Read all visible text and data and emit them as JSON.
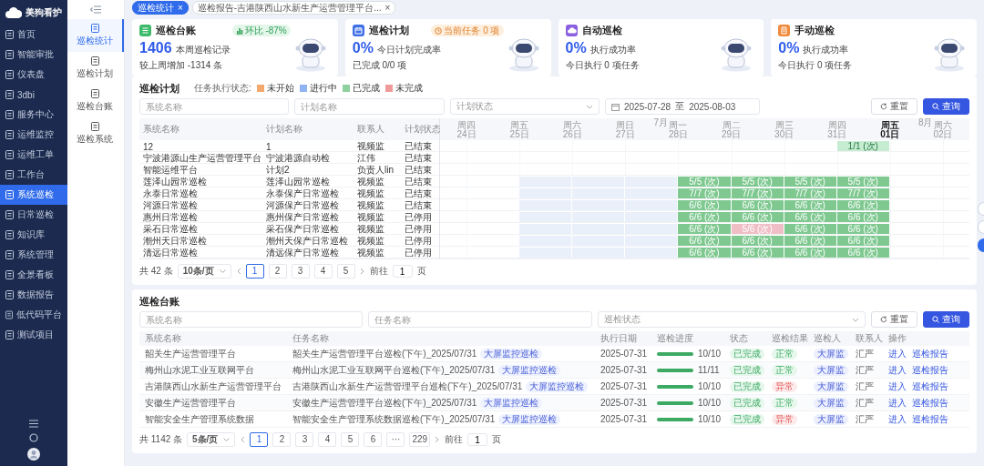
{
  "sidebar": {
    "logo": "美狗看护",
    "items": [
      {
        "label": "首页",
        "selected": false
      },
      {
        "label": "智能审批",
        "selected": false
      },
      {
        "label": "仪表盘",
        "selected": false
      },
      {
        "label": "3dbi",
        "selected": false
      },
      {
        "label": "服务中心",
        "selected": false
      },
      {
        "label": "运维监控",
        "selected": false
      },
      {
        "label": "运维工单",
        "selected": false
      },
      {
        "label": "工作台",
        "selected": false
      },
      {
        "label": "系统巡检",
        "selected": true
      },
      {
        "label": "日常巡检",
        "selected": false
      },
      {
        "label": "知识库",
        "selected": false
      },
      {
        "label": "系统管理",
        "selected": false
      },
      {
        "label": "全景看板",
        "selected": false
      },
      {
        "label": "数据报告",
        "selected": false
      },
      {
        "label": "低代码平台",
        "selected": false
      },
      {
        "label": "测试项目",
        "selected": false
      }
    ]
  },
  "subnav": {
    "items": [
      {
        "label": "巡检统计",
        "selected": true
      },
      {
        "label": "巡检计划",
        "selected": false
      },
      {
        "label": "巡检台账",
        "selected": false
      },
      {
        "label": "巡检系统",
        "selected": false
      }
    ]
  },
  "tabs": [
    {
      "label": "巡检统计",
      "close": "×",
      "selected": true
    },
    {
      "label": "巡检报告-吉港陕西山水新生产运营管理平台...",
      "close": "×",
      "selected": false
    }
  ],
  "cards": [
    {
      "kind": "ledger",
      "color": "#3dbb6b",
      "title": "巡检台账",
      "badge": {
        "kind": "trend",
        "text": "环比 -87%"
      },
      "value": "1406",
      "value_label": "本周巡检记录",
      "note": "较上周增加 -1314 条"
    },
    {
      "kind": "plan",
      "color": "#3f6fe6",
      "title": "巡检计划",
      "badge": {
        "kind": "pending",
        "text": "当前任务 0 项"
      },
      "value": "0%",
      "value_label": "今日计划完成率",
      "note": "已完成 0/0 项"
    },
    {
      "kind": "auto",
      "color": "#8a5fe0",
      "title": "自动巡检",
      "value": "0%",
      "value_label": "执行成功率",
      "note": "今日执行 0 项任务"
    },
    {
      "kind": "manual",
      "color": "#f08a3c",
      "title": "手动巡检",
      "value": "0%",
      "value_label": "执行成功率",
      "note": "今日执行 0 项任务"
    }
  ],
  "gantt": {
    "title": "巡检计划",
    "legend_label": "任务执行状态:",
    "legend": [
      {
        "label": "未开始",
        "color": "#f5a86b"
      },
      {
        "label": "进行中",
        "color": "#8fb3f3"
      },
      {
        "label": "已完成",
        "color": "#8fd19e"
      },
      {
        "label": "未完成",
        "color": "#ee9a9a"
      }
    ],
    "filters": [
      {
        "kind": "input",
        "placeholder": "系统名称"
      },
      {
        "kind": "input",
        "placeholder": "计划名称"
      },
      {
        "kind": "select",
        "placeholder": "计划状态"
      },
      {
        "kind": "daterange",
        "start": "2025-07-28",
        "separator": "至",
        "end": "2025-08-03"
      }
    ],
    "buttons": [
      {
        "kind": "default",
        "label": "重置"
      },
      {
        "kind": "primary",
        "label": "查询"
      }
    ],
    "columns": [
      "系统名称",
      "计划名称",
      "联系人",
      "计划状态"
    ],
    "days": [
      {
        "weekday": "周四",
        "date": "24日",
        "today": false
      },
      {
        "weekday": "周五",
        "date": "25日",
        "today": false
      },
      {
        "weekday": "周六",
        "date": "26日",
        "today": false
      },
      {
        "weekday": "周日",
        "date": "27日",
        "today": false
      },
      {
        "weekday": "周一",
        "date": "28日",
        "today": false,
        "month": "7月"
      },
      {
        "weekday": "周二",
        "date": "29日",
        "today": false
      },
      {
        "weekday": "周三",
        "date": "30日",
        "today": false
      },
      {
        "weekday": "周四",
        "date": "31日",
        "today": false
      },
      {
        "weekday": "周五",
        "date": "01日",
        "today": true
      },
      {
        "weekday": "周六",
        "date": "02日",
        "today": false,
        "month": "8月"
      }
    ],
    "rows": [
      {
        "cells": [
          "12",
          "1",
          "视频监",
          "已结束"
        ],
        "timeline": [
          {
            "kind": "empty"
          },
          {
            "kind": "empty"
          },
          {
            "kind": "empty"
          },
          {
            "kind": "empty"
          },
          {
            "kind": "empty"
          },
          {
            "kind": "empty"
          },
          {
            "kind": "empty"
          },
          {
            "kind": "ended",
            "label": "1/1 (次)"
          },
          {
            "kind": "empty"
          },
          {
            "kind": "empty"
          }
        ]
      },
      {
        "cells": [
          "宁波港源山生产运营管理平台",
          "宁波港源自动检",
          "江伟",
          "已结束"
        ],
        "timeline": [
          {
            "kind": "empty"
          },
          {
            "kind": "empty"
          },
          {
            "kind": "empty"
          },
          {
            "kind": "empty"
          },
          {
            "kind": "empty"
          },
          {
            "kind": "empty"
          },
          {
            "kind": "empty"
          },
          {
            "kind": "empty"
          },
          {
            "kind": "empty"
          },
          {
            "kind": "empty"
          }
        ]
      },
      {
        "cells": [
          "智能运维平台",
          "计划2",
          "负责人lin",
          "已结束"
        ],
        "timeline": [
          {
            "kind": "empty"
          },
          {
            "kind": "empty"
          },
          {
            "kind": "empty"
          },
          {
            "kind": "empty"
          },
          {
            "kind": "empty"
          },
          {
            "kind": "empty"
          },
          {
            "kind": "empty"
          },
          {
            "kind": "empty"
          },
          {
            "kind": "empty"
          },
          {
            "kind": "empty"
          }
        ]
      },
      {
        "cells": [
          "莲泽山园常巡检",
          "莲泽山园常巡检",
          "视频监",
          "已结束"
        ],
        "timeline": [
          {
            "kind": "empty"
          },
          {
            "kind": "planned"
          },
          {
            "kind": "planned"
          },
          {
            "kind": "planned"
          },
          {
            "kind": "done",
            "label": "5/5 (次)"
          },
          {
            "kind": "done",
            "label": "5/5 (次)"
          },
          {
            "kind": "done",
            "label": "5/5 (次)"
          },
          {
            "kind": "done",
            "label": "5/5 (次)"
          },
          {
            "kind": "empty"
          },
          {
            "kind": "empty"
          }
        ]
      },
      {
        "cells": [
          "永泰日常巡检",
          "永泰保产日常巡检",
          "视频监",
          "已结束"
        ],
        "timeline": [
          {
            "kind": "empty"
          },
          {
            "kind": "planned"
          },
          {
            "kind": "planned"
          },
          {
            "kind": "planned"
          },
          {
            "kind": "done",
            "label": "7/7 (次)"
          },
          {
            "kind": "done",
            "label": "7/7 (次)"
          },
          {
            "kind": "done",
            "label": "7/7 (次)"
          },
          {
            "kind": "done",
            "label": "7/7 (次)"
          },
          {
            "kind": "empty"
          },
          {
            "kind": "empty"
          }
        ]
      },
      {
        "cells": [
          "河源日常巡检",
          "河源保产日常巡检",
          "视频监",
          "已结束"
        ],
        "timeline": [
          {
            "kind": "empty"
          },
          {
            "kind": "planned"
          },
          {
            "kind": "planned"
          },
          {
            "kind": "planned"
          },
          {
            "kind": "done",
            "label": "6/6 (次)"
          },
          {
            "kind": "done",
            "label": "6/6 (次)"
          },
          {
            "kind": "done",
            "label": "6/6 (次)"
          },
          {
            "kind": "done",
            "label": "6/6 (次)"
          },
          {
            "kind": "empty"
          },
          {
            "kind": "empty"
          }
        ]
      },
      {
        "cells": [
          "惠州日常巡检",
          "惠州保产日常巡检",
          "视频监",
          "已停用"
        ],
        "timeline": [
          {
            "kind": "empty"
          },
          {
            "kind": "planned"
          },
          {
            "kind": "planned"
          },
          {
            "kind": "planned"
          },
          {
            "kind": "done",
            "label": "6/6 (次)"
          },
          {
            "kind": "done",
            "label": "6/6 (次)"
          },
          {
            "kind": "done",
            "label": "6/6 (次)"
          },
          {
            "kind": "done",
            "label": "6/6 (次)"
          },
          {
            "kind": "empty"
          },
          {
            "kind": "empty"
          }
        ]
      },
      {
        "cells": [
          "采石日常巡检",
          "采石保产日常巡检",
          "视频监",
          "已停用"
        ],
        "timeline": [
          {
            "kind": "empty"
          },
          {
            "kind": "planned"
          },
          {
            "kind": "planned"
          },
          {
            "kind": "planned"
          },
          {
            "kind": "done",
            "label": "6/6 (次)"
          },
          {
            "kind": "failed",
            "label": "5/6 (次)"
          },
          {
            "kind": "done",
            "label": "6/6 (次)"
          },
          {
            "kind": "done",
            "label": "6/6 (次)"
          },
          {
            "kind": "empty"
          },
          {
            "kind": "empty"
          }
        ]
      },
      {
        "cells": [
          "潮州天日常巡检",
          "潮州天保产日常巡检",
          "视频监",
          "已停用"
        ],
        "timeline": [
          {
            "kind": "empty"
          },
          {
            "kind": "planned"
          },
          {
            "kind": "planned"
          },
          {
            "kind": "planned"
          },
          {
            "kind": "done",
            "label": "6/6 (次)"
          },
          {
            "kind": "done",
            "label": "6/6 (次)"
          },
          {
            "kind": "done",
            "label": "6/6 (次)"
          },
          {
            "kind": "done",
            "label": "6/6 (次)"
          },
          {
            "kind": "empty"
          },
          {
            "kind": "empty"
          }
        ]
      },
      {
        "cells": [
          "清远日常巡检",
          "清远保产日常巡检",
          "视频监",
          "已停用"
        ],
        "timeline": [
          {
            "kind": "empty"
          },
          {
            "kind": "planned"
          },
          {
            "kind": "planned"
          },
          {
            "kind": "planned"
          },
          {
            "kind": "done",
            "label": "6/6 (次)"
          },
          {
            "kind": "done",
            "label": "6/6 (次)"
          },
          {
            "kind": "done",
            "label": "6/6 (次)"
          },
          {
            "kind": "done",
            "label": "6/6 (次)"
          },
          {
            "kind": "empty"
          },
          {
            "kind": "empty"
          }
        ]
      }
    ],
    "pagination": {
      "total": "共 42 条",
      "page_size": "10条/页",
      "pages": [
        {
          "label": "1",
          "selected": true
        },
        {
          "label": "2",
          "selected": false
        },
        {
          "label": "3",
          "selected": false
        },
        {
          "label": "4",
          "selected": false
        },
        {
          "label": "5",
          "selected": false
        }
      ],
      "goto_label": "前往",
      "goto_value": "1",
      "goto_suffix": "页"
    }
  },
  "ledger": {
    "title": "巡检台账",
    "filters": [
      {
        "kind": "input",
        "placeholder": "系统名称"
      },
      {
        "kind": "input",
        "placeholder": "任务名称"
      },
      {
        "kind": "select",
        "placeholder": "巡检状态"
      }
    ],
    "buttons": [
      {
        "kind": "default",
        "label": "重置"
      },
      {
        "kind": "primary",
        "label": "查询"
      }
    ],
    "columns": [
      "系统名称",
      "任务名称",
      "执行日期",
      "巡检进度",
      "状态",
      "巡检结果",
      "巡检人",
      "联系人",
      "操作"
    ],
    "rows": [
      {
        "system": "韶关生产运营管理平台",
        "task": "韶关生产运营管理平台巡检(下午)_2025/07/31",
        "tag": "大屏监控巡检",
        "date": "2025-07-31",
        "progress": {
          "level": 1,
          "reading": "10/10"
        },
        "status": {
          "label": "已完成",
          "kind": "success"
        },
        "result": {
          "label": "正常",
          "kind": "success"
        },
        "inspector": "大屏监",
        "contact": "汇严",
        "actions": [
          "进入",
          "巡检报告"
        ]
      },
      {
        "system": "梅州山水泥工业互联网平台",
        "task": "梅州山水泥工业互联网平台巡检(下午)_2025/07/31",
        "tag": "大屏监控巡检",
        "date": "2025-07-31",
        "progress": {
          "level": 1,
          "reading": "11/11"
        },
        "status": {
          "label": "已完成",
          "kind": "success"
        },
        "result": {
          "label": "正常",
          "kind": "success"
        },
        "inspector": "大屏监",
        "contact": "汇严",
        "actions": [
          "进入",
          "巡检报告"
        ]
      },
      {
        "system": "吉港陕西山水新生产运营管理平台",
        "task": "吉港陕西山水新生产运营管理平台巡检(下午)_2025/07/31",
        "tag": "大屏监控巡检",
        "date": "2025-07-31",
        "progress": {
          "level": 1,
          "reading": "10/10"
        },
        "status": {
          "label": "已完成",
          "kind": "success"
        },
        "result": {
          "label": "异常",
          "kind": "danger"
        },
        "inspector": "大屏监",
        "contact": "汇严",
        "actions": [
          "进入",
          "巡检报告"
        ]
      },
      {
        "system": "安徽生产运营管理平台",
        "task": "安徽生产运营管理平台巡检(下午)_2025/07/31",
        "tag": "大屏监控巡检",
        "date": "2025-07-31",
        "progress": {
          "level": 1,
          "reading": "10/10"
        },
        "status": {
          "label": "已完成",
          "kind": "success"
        },
        "result": {
          "label": "正常",
          "kind": "success"
        },
        "inspector": "大屏监",
        "contact": "汇严",
        "actions": [
          "进入",
          "巡检报告"
        ]
      },
      {
        "system": "智能安全生产管理系统数据",
        "task": "智能安全生产管理系统数据巡检(下午)_2025/07/31",
        "tag": "大屏监控巡检",
        "date": "2025-07-31",
        "progress": {
          "level": 1,
          "reading": "10/10"
        },
        "status": {
          "label": "已完成",
          "kind": "success"
        },
        "result": {
          "label": "异常",
          "kind": "danger"
        },
        "inspector": "大屏监",
        "contact": "汇严",
        "actions": [
          "进入",
          "巡检报告"
        ]
      }
    ],
    "pagination": {
      "total": "共 1142 条",
      "page_size": "5条/页",
      "pages": [
        {
          "label": "1",
          "selected": true
        },
        {
          "label": "2",
          "selected": false
        },
        {
          "label": "3",
          "selected": false
        },
        {
          "label": "4",
          "selected": false
        },
        {
          "label": "5",
          "selected": false
        },
        {
          "label": "6",
          "selected": false
        },
        {
          "label": "···",
          "selected": false
        },
        {
          "label": "229",
          "selected": false
        }
      ],
      "goto_label": "前往",
      "goto_value": "1",
      "goto_suffix": "页"
    }
  }
}
